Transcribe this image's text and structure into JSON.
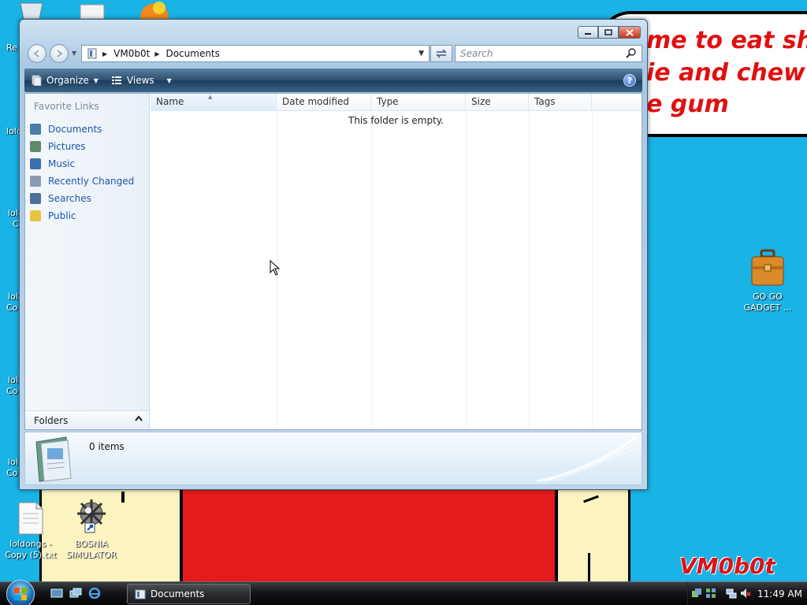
{
  "wallpaper": {
    "bubble_lines": [
      "me to eat shit",
      "ie and chew",
      "e gum"
    ],
    "signature": "VM0b0t"
  },
  "desktop": {
    "left_edge_labels": [
      "Re",
      "lold",
      "lold",
      "lold",
      "lold",
      "lold",
      "C",
      "Co",
      "Co",
      "Co"
    ],
    "icons": [
      {
        "name": "loldongs-file",
        "label_line1": "loldongs -",
        "label_line2": "Copy (5).txt"
      },
      {
        "name": "bosnia-simulator",
        "label_line1": "BOSNIA",
        "label_line2": "SIMULATOR"
      },
      {
        "name": "go-go-gadget",
        "label_line1": "GO GO",
        "label_line2": "GADGET ..."
      }
    ]
  },
  "window": {
    "title": "Documents",
    "address": {
      "root": "VM0b0t",
      "current": "Documents"
    },
    "search": {
      "placeholder": "Search"
    },
    "toolbar": {
      "organize": "Organize",
      "views": "Views",
      "help": "?"
    },
    "nav_pane": {
      "title": "Favorite Links",
      "links": [
        {
          "label": "Documents",
          "icon": "documents-icon",
          "color": "#4a7ea8"
        },
        {
          "label": "Pictures",
          "icon": "pictures-icon",
          "color": "#5f8a6a"
        },
        {
          "label": "Music",
          "icon": "music-icon",
          "color": "#3b6fb0"
        },
        {
          "label": "Recently Changed",
          "icon": "recently-changed-icon",
          "color": "#8a9bb3"
        },
        {
          "label": "Searches",
          "icon": "searches-icon",
          "color": "#4d6f99"
        },
        {
          "label": "Public",
          "icon": "public-icon",
          "color": "#e9c443"
        }
      ],
      "folders_label": "Folders"
    },
    "columns": [
      "Name",
      "Date modified",
      "Type",
      "Size",
      "Tags"
    ],
    "empty_message": "This folder is empty.",
    "details": {
      "item_count": "0 items"
    }
  },
  "taskbar": {
    "task_button": "Documents",
    "clock": "11:49 AM"
  }
}
